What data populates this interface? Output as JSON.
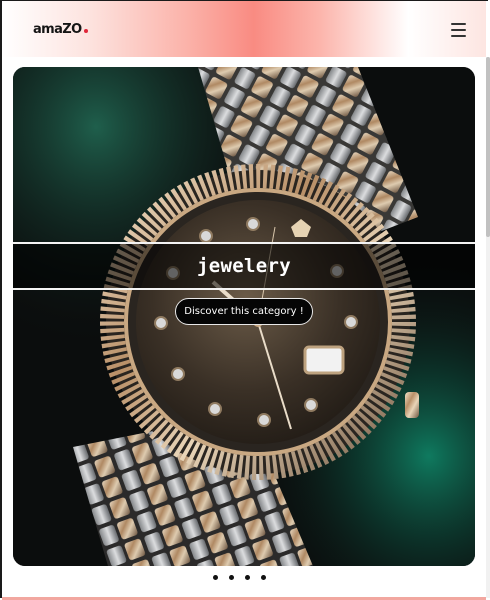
{
  "header": {
    "logo_text": "amaZO",
    "menu_icon": "hamburger-menu-icon"
  },
  "hero": {
    "title": "jewelery",
    "cta_label": "Discover this category !",
    "image": "wristwatch-photo"
  },
  "carousel": {
    "dots": 4
  },
  "colors": {
    "accent": "#f98b82",
    "logo_dot": "#e0263a",
    "cta_background": "#050505"
  }
}
